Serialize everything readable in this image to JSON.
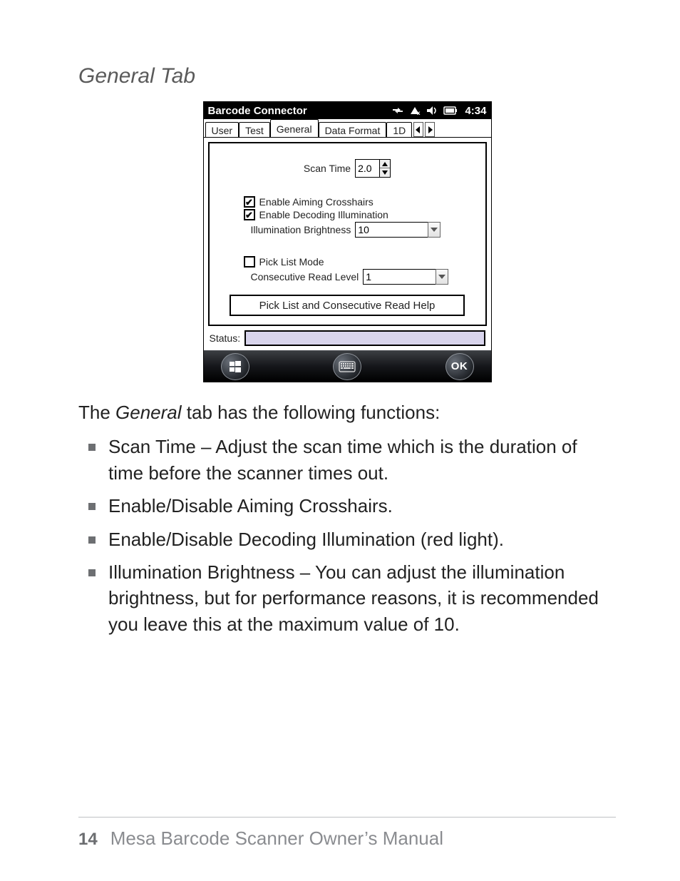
{
  "section_title": "General Tab",
  "device": {
    "titlebar": {
      "title": "Barcode Connector",
      "clock": "4:34",
      "icons": [
        "network-sync-icon",
        "signal-off-icon",
        "volume-icon",
        "battery-icon"
      ]
    },
    "tabs": [
      {
        "label": "User",
        "active": false
      },
      {
        "label": "Test",
        "active": false
      },
      {
        "label": "General",
        "active": true
      },
      {
        "label": "Data Format",
        "active": false
      },
      {
        "label": "1D",
        "active": false
      }
    ],
    "panel": {
      "scan_time": {
        "label": "Scan Time",
        "value": "2.0"
      },
      "aiming": {
        "label": "Enable Aiming Crosshairs",
        "checked": true
      },
      "decode": {
        "label": "Enable Decoding Illumination",
        "checked": true
      },
      "brightness": {
        "label": "Illumination Brightness",
        "value": "10"
      },
      "picklist": {
        "label": "Pick List Mode",
        "checked": false
      },
      "readlevel": {
        "label": "Consecutive Read Level",
        "value": "1"
      },
      "help_button": "Pick List and Consecutive Read Help"
    },
    "status": {
      "label": "Status:",
      "value": ""
    },
    "softkeys": {
      "start": "start",
      "keyboard": "keyboard",
      "ok": "OK"
    }
  },
  "body": {
    "intro_pre": "The ",
    "intro_em": "General",
    "intro_post": " tab has the following functions:",
    "bullets": [
      "Scan Time – Adjust the scan time which is the duration of time before the scanner times out.",
      "Enable/Disable Aiming Crosshairs.",
      "Enable/Disable Decoding Illumination (red light).",
      "Illumination Brightness – You can adjust the illumination brightness, but for performance reasons, it is recommended you leave this at the maximum value of 10."
    ]
  },
  "footer": {
    "page": "14",
    "title": "Mesa Barcode Scanner Owner’s Manual"
  }
}
